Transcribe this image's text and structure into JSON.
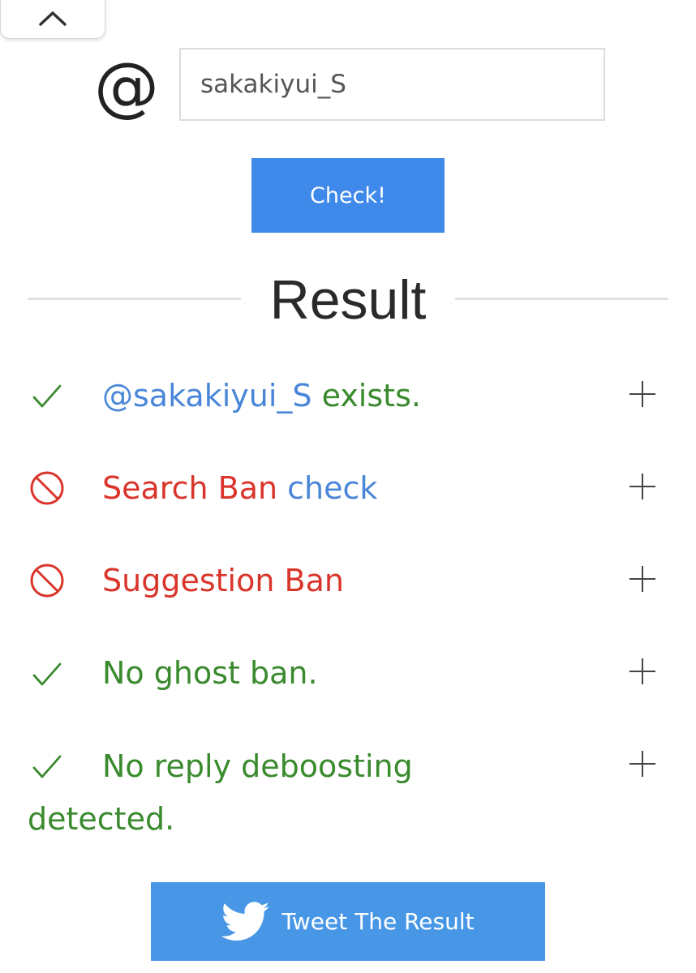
{
  "header": {
    "collapse_icon": "chevron-up-icon"
  },
  "form": {
    "at_symbol": "@",
    "username_value": "sakakiyui_S",
    "check_label": "Check!"
  },
  "result": {
    "title": "Result",
    "rows": [
      {
        "status": "ok",
        "icon": "check-icon",
        "handle": "@sakakiyui_S",
        "text": " exists."
      },
      {
        "status": "banned",
        "icon": "prohibited-icon",
        "text": "Search Ban ",
        "link": "check"
      },
      {
        "status": "banned",
        "icon": "prohibited-icon",
        "text": "Suggestion Ban"
      },
      {
        "status": "ok",
        "icon": "check-icon",
        "text": "No ghost ban."
      },
      {
        "status": "ok",
        "icon": "check-icon",
        "text": "No reply deboosting",
        "text_continued": "detected."
      }
    ],
    "expand_icon": "plus-icon"
  },
  "share": {
    "tweet_label": "Tweet The Result",
    "icon": "twitter-bird-icon"
  },
  "colors": {
    "accent_blue": "#3f89ea",
    "tweet_blue": "#4897e6",
    "ok_green": "#3a8a2e",
    "ban_red": "#d9352b",
    "link_blue": "#4a86d8"
  }
}
